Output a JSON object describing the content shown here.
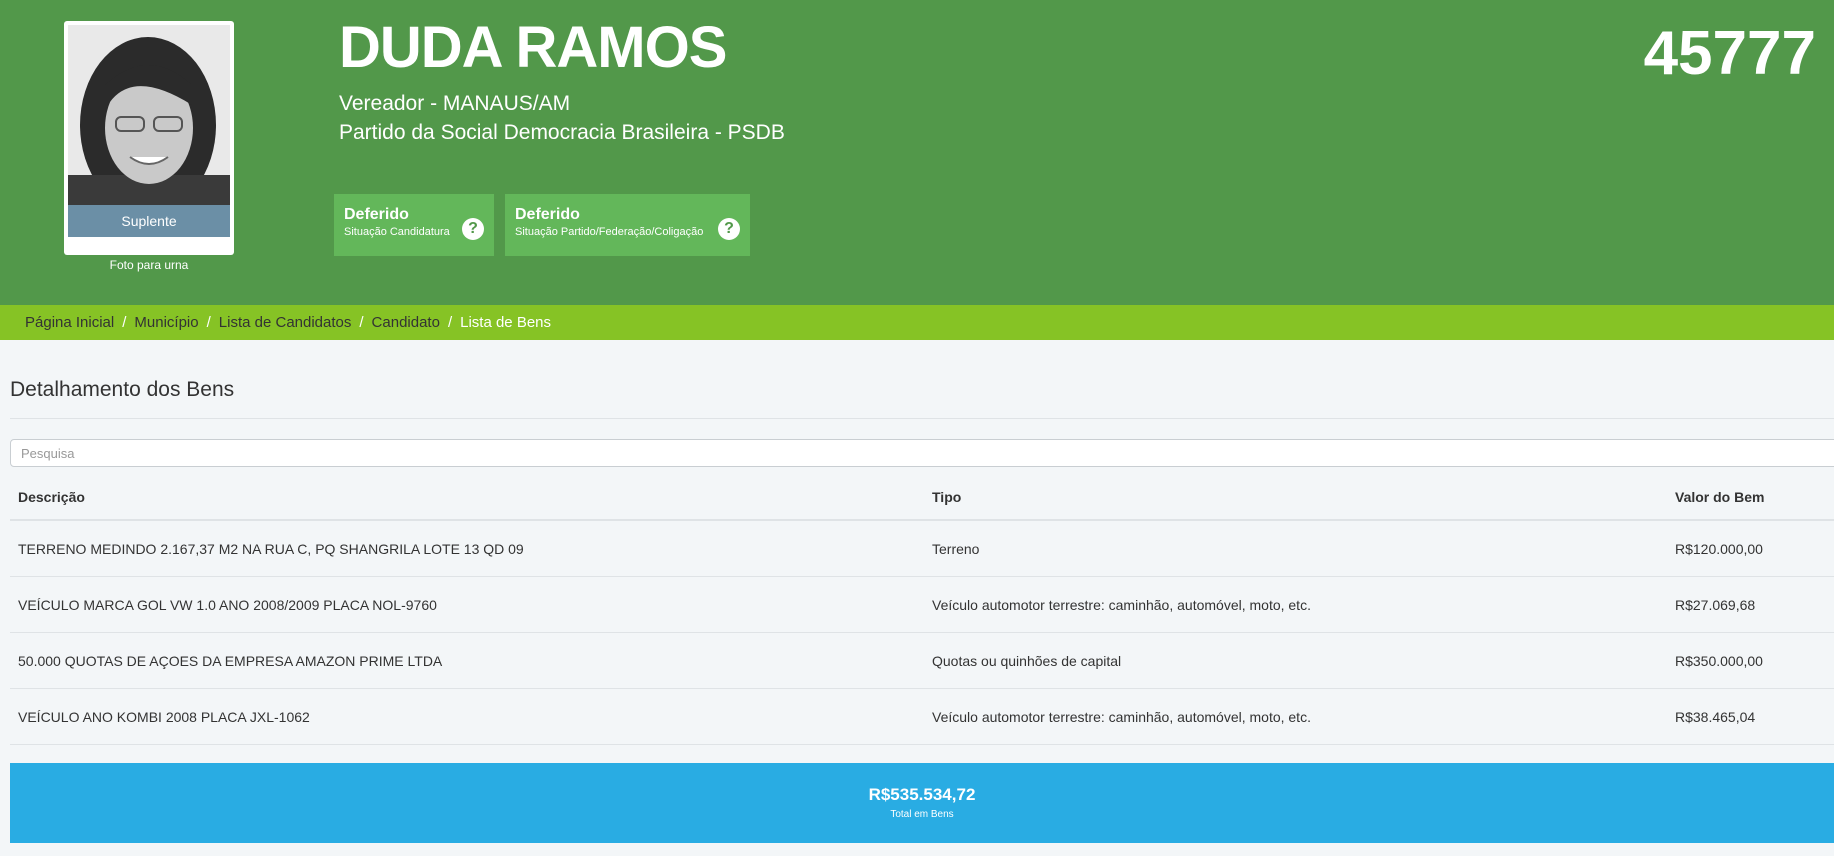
{
  "candidate": {
    "name": "DUDA RAMOS",
    "role": "Vereador - MANAUS/AM",
    "party": "Partido da Social Democracia Brasileira - PSDB",
    "number": "45777",
    "photo_status": "Suplente",
    "photo_caption": "Foto para urna"
  },
  "badges": [
    {
      "title": "Deferido",
      "subtitle": "Situação Candidatura",
      "icon": "help-icon"
    },
    {
      "title": "Deferido",
      "subtitle": "Situação Partido/Federação/Coligação",
      "icon": "help-icon"
    }
  ],
  "breadcrumb": [
    "Página Inicial",
    "Município",
    "Lista de Candidatos",
    "Candidato",
    "Lista de Bens"
  ],
  "section": {
    "title": "Detalhamento dos Bens",
    "search_placeholder": "Pesquisa"
  },
  "table": {
    "headers": [
      "Descrição",
      "Tipo",
      "Valor do Bem"
    ],
    "rows": [
      [
        "TERRENO MEDINDO 2.167,37 M2 NA RUA C, PQ SHANGRILA LOTE 13 QD 09",
        "Terreno",
        "R$120.000,00"
      ],
      [
        "VEÍCULO MARCA GOL VW 1.0 ANO 2008/2009 PLACA NOL-9760",
        "Veículo automotor terrestre: caminhão, automóvel, moto, etc.",
        "R$27.069,68"
      ],
      [
        "50.000 QUOTAS DE AÇOES DA EMPRESA AMAZON PRIME LTDA",
        "Quotas ou quinhões de capital",
        "R$350.000,00"
      ],
      [
        "VEÍCULO ANO KOMBI 2008 PLACA JXL-1062",
        "Veículo automotor terrestre: caminhão, automóvel, moto, etc.",
        "R$38.465,04"
      ]
    ]
  },
  "total": {
    "value": "R$535.534,72",
    "label": "Total em Bens"
  },
  "colors": {
    "header_bg": "#52984a",
    "breadcrumb_bg": "#86c325",
    "badge_bg": "#63b75a",
    "total_bg": "#29ace3",
    "status_bg": "#6b8fa6"
  }
}
